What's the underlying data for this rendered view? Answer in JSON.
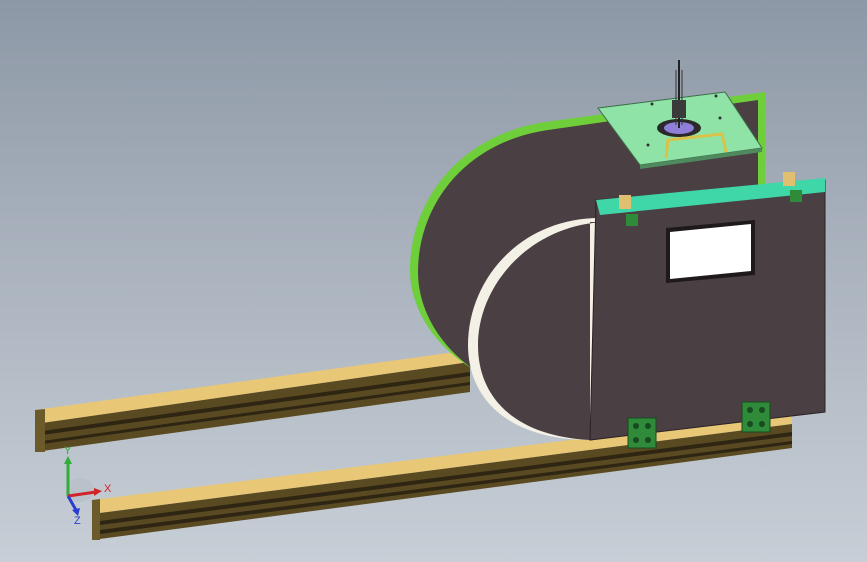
{
  "viewport": {
    "background_top": "#8d98a6",
    "background_bottom": "#c7ced6"
  },
  "model": {
    "body_color": "#4a3f43",
    "curved_edge_color": "#6fcf3a",
    "top_plate_color": "#8fe3a6",
    "front_strip_color": "#3fd6a8",
    "rail_top_color": "#e8c777",
    "rail_side_color": "#5a4a22",
    "window_color": "#ffffff",
    "clamp_color": "#2f8a3a",
    "handle_color": "#d8c24a"
  },
  "triad": {
    "x_label": "X",
    "y_label": "Y",
    "z_label": "Z",
    "x_color": "#d0242b",
    "y_color": "#2fae3a",
    "z_color": "#2a3fcf"
  }
}
